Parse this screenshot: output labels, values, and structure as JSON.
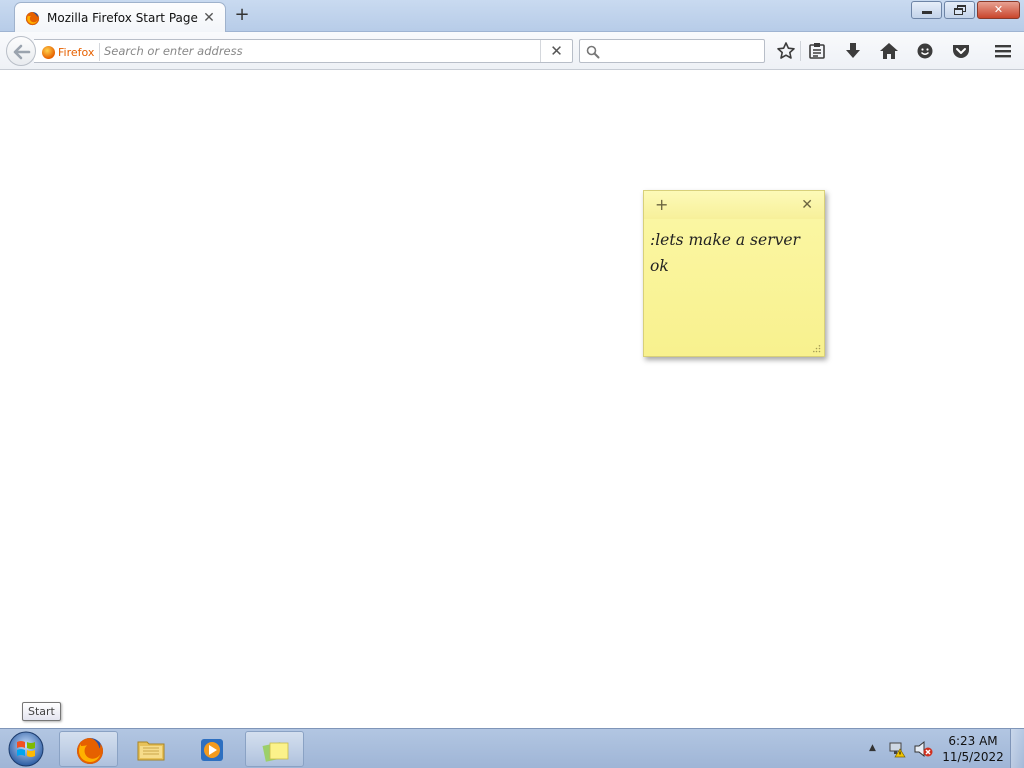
{
  "browser": {
    "tab": {
      "title": "Mozilla Firefox Start Page",
      "close_glyph": "✕"
    },
    "new_tab_glyph": "+",
    "identity_label": "Firefox",
    "url": {
      "value": "",
      "placeholder": "Search or enter address",
      "clear_glyph": "✕"
    },
    "search": {
      "value": "",
      "placeholder": ""
    },
    "toolbar_icons": [
      "bookmark-star-icon",
      "reading-list-icon",
      "downloads-icon",
      "home-icon",
      "chat-smiley-icon",
      "pocket-icon",
      "hamburger-menu-icon"
    ]
  },
  "sticky_note": {
    "add_glyph": "+",
    "close_glyph": "✕",
    "text": ":lets make a server\nok"
  },
  "tooltip": {
    "text": "Start"
  },
  "taskbar": {
    "items": [
      "start-orb",
      "firefox-taskbar-item",
      "file-explorer-taskbar-item",
      "media-player-taskbar-item",
      "sticky-notes-taskbar-item"
    ],
    "tray_arrow_glyph": "▲",
    "clock": {
      "time": "6:23 AM",
      "date": "11/5/2022"
    }
  },
  "colors": {
    "firefox_orange": "#e66000",
    "sticky_yellow": "#fbf7a6",
    "taskbar_blue": "#a9bfdd"
  }
}
